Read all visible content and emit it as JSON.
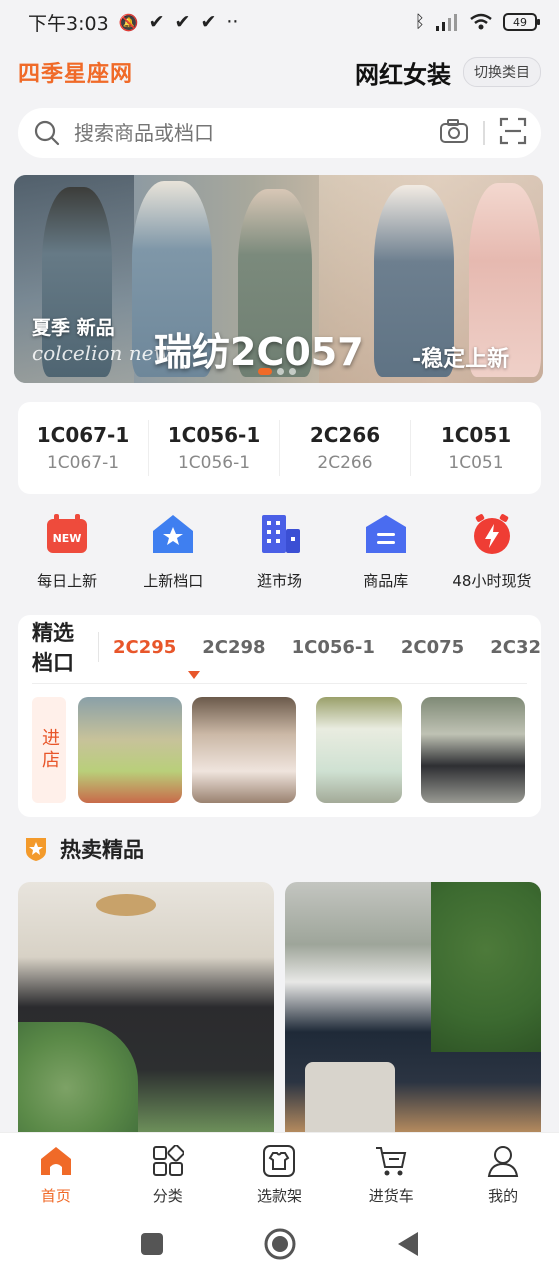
{
  "status_bar": {
    "time": "下午3:03",
    "battery": "49"
  },
  "header": {
    "logo_text": "四季星座网",
    "category_title": "网红女装",
    "switch_label": "切换类目"
  },
  "search": {
    "placeholder": "搜索商品或档口"
  },
  "banner": {
    "subtitle": "夏季  新品",
    "script_text": "colcelion new",
    "main_text": "瑞纺2C057",
    "tag_text": "-稳定上新"
  },
  "stalls": [
    {
      "code": "1C067-1",
      "sub": "1C067-1"
    },
    {
      "code": "1C056-1",
      "sub": "1C056-1"
    },
    {
      "code": "2C266",
      "sub": "2C266"
    },
    {
      "code": "1C051",
      "sub": "1C051"
    }
  ],
  "quick_nav": [
    {
      "label": "每日上新",
      "icon": "new-calendar-icon",
      "badge": "NEW"
    },
    {
      "label": "上新档口",
      "icon": "star-house-icon"
    },
    {
      "label": "逛市场",
      "icon": "building-icon"
    },
    {
      "label": "商品库",
      "icon": "warehouse-icon"
    },
    {
      "label": "48小时现货",
      "icon": "lightning-clock-icon"
    }
  ],
  "selected_stalls": {
    "title": "精选档口",
    "tabs": [
      "2C295",
      "2C298",
      "1C056-1",
      "2C075",
      "2C32"
    ],
    "active_tab": "2C295",
    "enter_label": "进店"
  },
  "hot": {
    "title": "热卖精品"
  },
  "bottom_nav": [
    {
      "label": "首页",
      "icon": "home-icon",
      "active": true
    },
    {
      "label": "分类",
      "icon": "category-icon"
    },
    {
      "label": "选款架",
      "icon": "shirt-box-icon"
    },
    {
      "label": "进货车",
      "icon": "cart-icon"
    },
    {
      "label": "我的",
      "icon": "user-icon"
    }
  ],
  "colors": {
    "accent": "#f06a28",
    "tab_active": "#e8562a"
  }
}
